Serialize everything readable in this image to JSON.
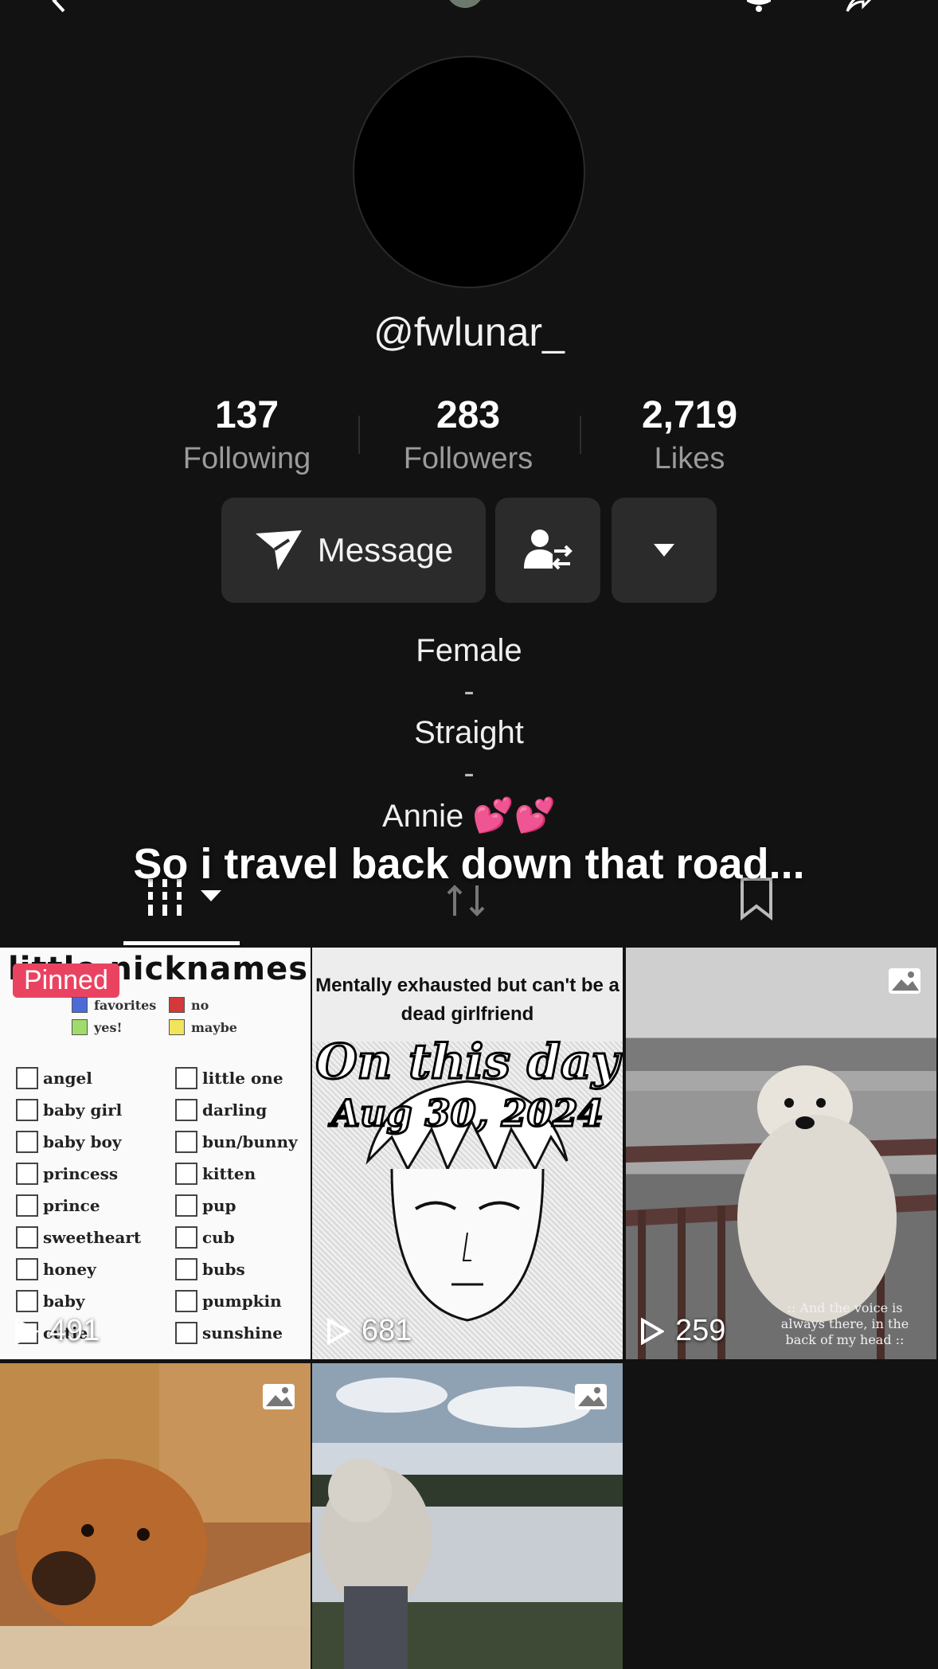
{
  "profile": {
    "username": "@fwlunar_",
    "stats": [
      {
        "value": "137",
        "label": "Following"
      },
      {
        "value": "283",
        "label": "Followers"
      },
      {
        "value": "2,719",
        "label": "Likes"
      }
    ]
  },
  "actions": {
    "message_label": "Message"
  },
  "bio": {
    "line1": "Female",
    "sep1": "-",
    "line2": "Straight",
    "sep2": "-",
    "line3": "Annie",
    "hearts": "💕💕"
  },
  "overlay_caption": "So i travel back down that road...",
  "videos": [
    {
      "views": "491",
      "pinned_label": "Pinned",
      "title": "little nicknames",
      "legend": [
        {
          "label": "favorites",
          "color": "#4b6bd6"
        },
        {
          "label": "no",
          "color": "#d23a3a"
        },
        {
          "label": "yes!",
          "color": "#9fdc6c"
        },
        {
          "label": "maybe",
          "color": "#f1e35c"
        }
      ],
      "nicknames_left": [
        "angel",
        "baby girl",
        "baby boy",
        "princess",
        "prince",
        "sweetheart",
        "honey",
        "baby",
        "cutie"
      ],
      "nicknames_right": [
        "little one",
        "darling",
        "bun/bunny",
        "kitten",
        "pup",
        "cub",
        "bubs",
        "pumpkin",
        "sunshine"
      ]
    },
    {
      "views": "681",
      "header": "Mentally exhausted but can't be a dead girlfriend",
      "onday_line1": "On this day",
      "onday_line2": "Aug 30, 2024"
    },
    {
      "views": "259",
      "caption": ":: And the voice is always there, in the back of my head ::"
    },
    {},
    {}
  ],
  "colors": {
    "background": "#121212",
    "button": "#2b2b2b",
    "pinned": "#ea4361",
    "muted_text": "#9b9b9b"
  },
  "icons": [
    "back-icon",
    "notification-icon",
    "share-icon",
    "send-icon",
    "follow-swap-icon",
    "dropdown-icon",
    "grid-tab-icon",
    "repost-tab-icon",
    "bookmark-tab-icon",
    "play-icon",
    "image-icon"
  ]
}
